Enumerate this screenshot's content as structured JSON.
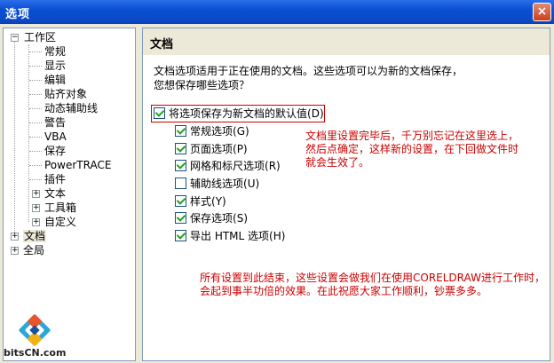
{
  "window": {
    "title": "选项",
    "close_glyph": "×"
  },
  "tree": {
    "workspace": {
      "label": "工作区",
      "expander": "−"
    },
    "children": [
      "常规",
      "显示",
      "编辑",
      "贴齐对象",
      "动态辅助线",
      "警告",
      "VBA",
      "保存",
      "PowerTRACE",
      "插件"
    ],
    "expandable": [
      {
        "label": "文本",
        "expander": "+"
      },
      {
        "label": "工具箱",
        "expander": "+"
      },
      {
        "label": "自定义",
        "expander": "+"
      }
    ],
    "document": {
      "label": "文档",
      "expander": "+"
    },
    "global": {
      "label": "全局",
      "expander": "+"
    }
  },
  "panel": {
    "heading": "文档",
    "description_line1": "文档选项适用于正在使用的文档。这些选项可以为新的文档保存，",
    "description_line2": "您想保存哪些选项？",
    "save_default": {
      "label": "将选项保存为新文档的默认值",
      "mnemonic": "(D)",
      "checked": true
    },
    "options": [
      {
        "label": "常规选项",
        "mnemonic": "(G)",
        "checked": true
      },
      {
        "label": "页面选项",
        "mnemonic": "(P)",
        "checked": true
      },
      {
        "label": "网格和标尺选项",
        "mnemonic": "(R)",
        "checked": true
      },
      {
        "label": "辅助线选项",
        "mnemonic": "(U)",
        "checked": false
      },
      {
        "label": "样式",
        "mnemonic": "(Y)",
        "checked": true
      },
      {
        "label": "保存选项",
        "mnemonic": "(S)",
        "checked": true
      },
      {
        "label": "导出 HTML 选项",
        "mnemonic": "(H)",
        "checked": true
      }
    ]
  },
  "annotations": {
    "note1": [
      "文档里设置完毕后，千万别忘记在这里选上，",
      "然后点确定，这样新的设置，在下回做文件时",
      "就会生效了。"
    ],
    "note2": [
      "所有设置到此结束，这些设置会做我们在使用CORELDRAW进行工作时，",
      "会起到事半功倍的效果。在此祝愿大家工作顺利，钞票多多。"
    ]
  },
  "watermark": {
    "text": "bitsCN.com"
  },
  "colors": {
    "titlebar": "#0a4fd4",
    "annotation_red": "#cc0000",
    "check_green": "#21a121"
  }
}
